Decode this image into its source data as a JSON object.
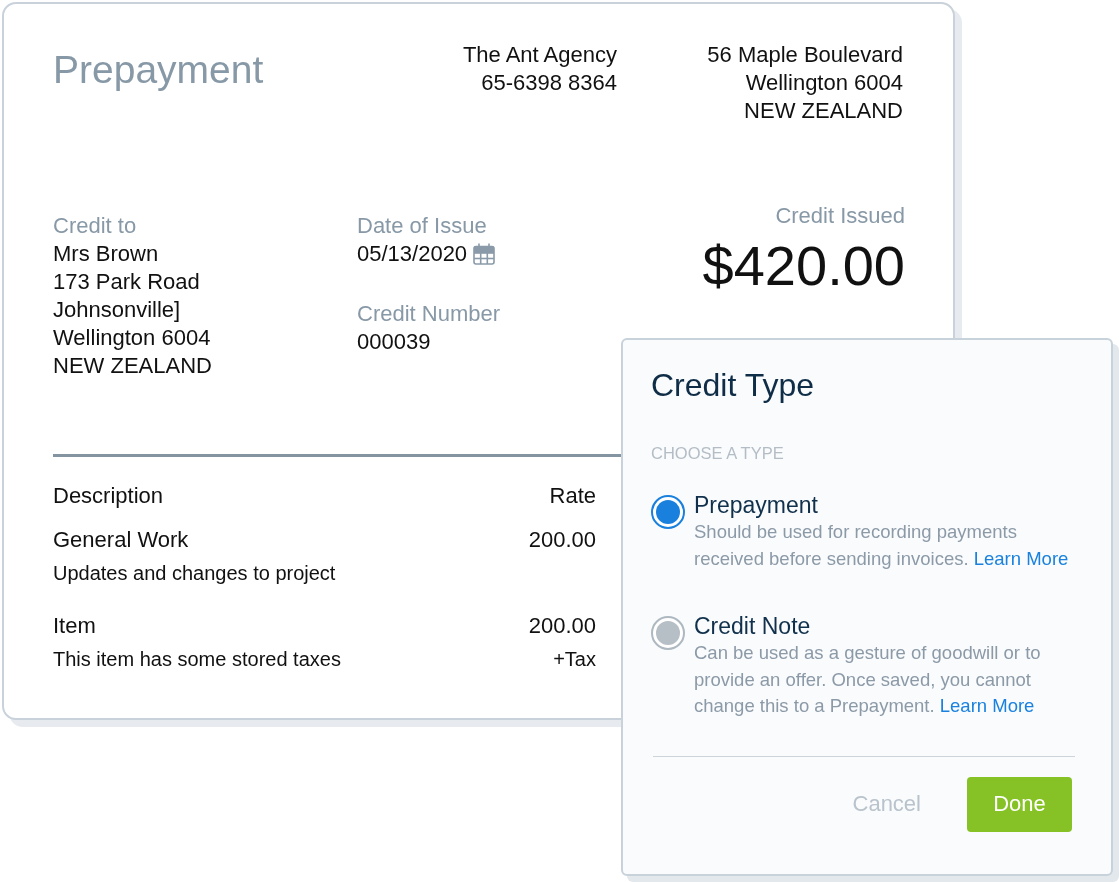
{
  "document": {
    "title": "Prepayment",
    "company": {
      "name": "The Ant Agency",
      "phone": "65-6398 8364"
    },
    "company_address": [
      "56 Maple Boulevard",
      "Wellington 6004",
      "NEW ZEALAND"
    ],
    "credit_to": {
      "label": "Credit to",
      "lines": [
        "Mrs Brown",
        "173 Park Road",
        "Johnsonville]",
        "Wellington 6004",
        "NEW ZEALAND"
      ]
    },
    "date_of_issue": {
      "label": "Date of Issue",
      "value": "05/13/2020"
    },
    "credit_number": {
      "label": "Credit Number",
      "value": "000039"
    },
    "credit_issued": {
      "label": "Credit Issued",
      "amount": "$420.00"
    },
    "table": {
      "columns": [
        "Description",
        "Rate"
      ],
      "rows": [
        {
          "name": "General Work",
          "description": "Updates and changes to project",
          "rate": "200.00"
        },
        {
          "name": "Item",
          "description": "This item has some stored taxes",
          "rate": "200.00",
          "tax": "+Tax"
        }
      ]
    }
  },
  "dialog": {
    "title": "Credit Type",
    "section_label": "CHOOSE A TYPE",
    "options": [
      {
        "label": "Prepayment",
        "description": "Should be used for recording payments received before sending invoices.",
        "link": "Learn More",
        "selected": true
      },
      {
        "label": "Credit Note",
        "description": "Can be used as a gesture of goodwill or to provide an offer. Once saved, you cannot change this to a Prepayment.",
        "link": "Learn More",
        "selected": false
      }
    ],
    "buttons": [
      {
        "label": "Cancel",
        "kind": "plain"
      },
      {
        "label": "Done",
        "kind": "primary"
      }
    ]
  }
}
